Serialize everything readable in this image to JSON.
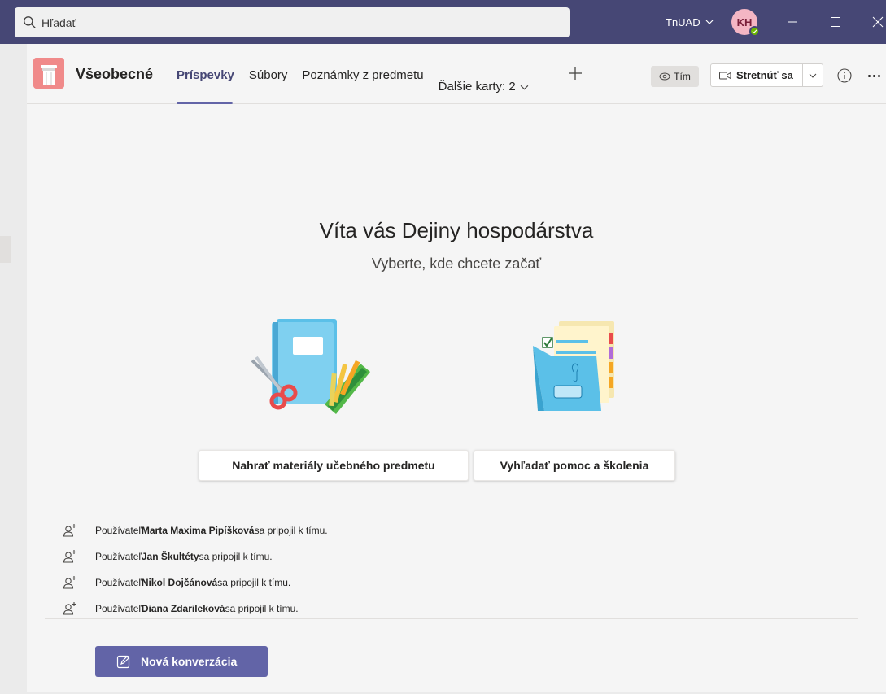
{
  "search": {
    "placeholder": "Hľadať"
  },
  "titlebar": {
    "org": "TnUAD",
    "avatar_initials": "KH",
    "presence_color": "#6bb700",
    "accent": "#464775"
  },
  "header": {
    "channel_name": "Všeobecné",
    "tabs": [
      {
        "label": "Príspevky",
        "active": true
      },
      {
        "label": "Súbory",
        "active": false
      },
      {
        "label": "Poznámky z predmetu",
        "active": false
      }
    ],
    "more_tabs_label": "Ďalšie karty: 2",
    "team_button": "Tím",
    "meet_button": "Stretnúť sa"
  },
  "welcome": {
    "title": "Víta vás Dejiny hospodárstva",
    "subtitle": "Vyberte, kde chcete začať"
  },
  "actions": {
    "upload": "Nahrať materiály učebného predmetu",
    "help": "Vyhľadať pomoc a školenia"
  },
  "activity": [
    {
      "prefix": "Používateľ ",
      "name": "Marta Maxima Pipíšková",
      "suffix": " sa pripojil k tímu."
    },
    {
      "prefix": "Používateľ ",
      "name": "Jan Škultéty",
      "suffix": " sa pripojil k tímu."
    },
    {
      "prefix": "Používateľ ",
      "name": "Nikol Dojčánová",
      "suffix": " sa pripojil k tímu."
    },
    {
      "prefix": "Používateľ ",
      "name": "Diana Zdarileková",
      "suffix": " sa pripojil k tímu."
    }
  ],
  "compose": {
    "new_conversation": "Nová konverzácia"
  },
  "icons": [
    "search-icon",
    "chevron-down-icon",
    "minimize-icon",
    "maximize-icon",
    "close-icon",
    "team-icon",
    "plus-icon",
    "eye-icon",
    "video-call-icon",
    "info-icon",
    "more-icon",
    "user-joined-icon",
    "compose-icon"
  ]
}
